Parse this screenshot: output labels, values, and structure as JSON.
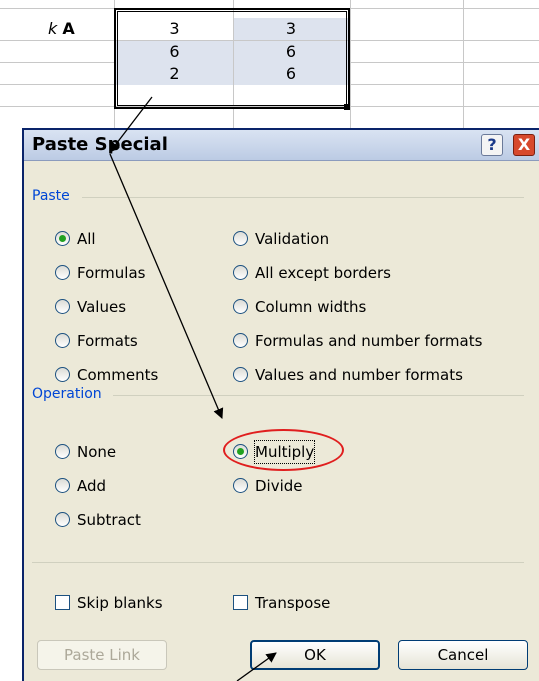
{
  "sheet": {
    "row1": {
      "label_k": "k",
      "label_a": "A",
      "col_b": "3",
      "col_c": "3"
    },
    "row2": {
      "col_b": "6",
      "col_c": "6"
    },
    "row3": {
      "col_b": "2",
      "col_c": "6"
    }
  },
  "dialog": {
    "title": "Paste Special",
    "help_button": "?",
    "close_button": "X",
    "paste_group": {
      "label": "Paste",
      "left_options": [
        "All",
        "Formulas",
        "Values",
        "Formats",
        "Comments"
      ],
      "right_options": [
        "Validation",
        "All except borders",
        "Column widths",
        "Formulas and number formats",
        "Values and number formats"
      ],
      "selected": "All"
    },
    "operation_group": {
      "label": "Operation",
      "left_options": [
        "None",
        "Add",
        "Subtract"
      ],
      "right_options": [
        "Multiply",
        "Divide"
      ],
      "selected": "Multiply"
    },
    "checkboxes": {
      "skip_blanks": "Skip blanks",
      "transpose": "Transpose"
    },
    "buttons": {
      "paste_link": "Paste Link",
      "ok": "OK",
      "cancel": "Cancel"
    }
  },
  "colors": {
    "annotation_circle": "#e01e1e",
    "group_label": "#0046d5",
    "radio_dot": "#21a121"
  }
}
